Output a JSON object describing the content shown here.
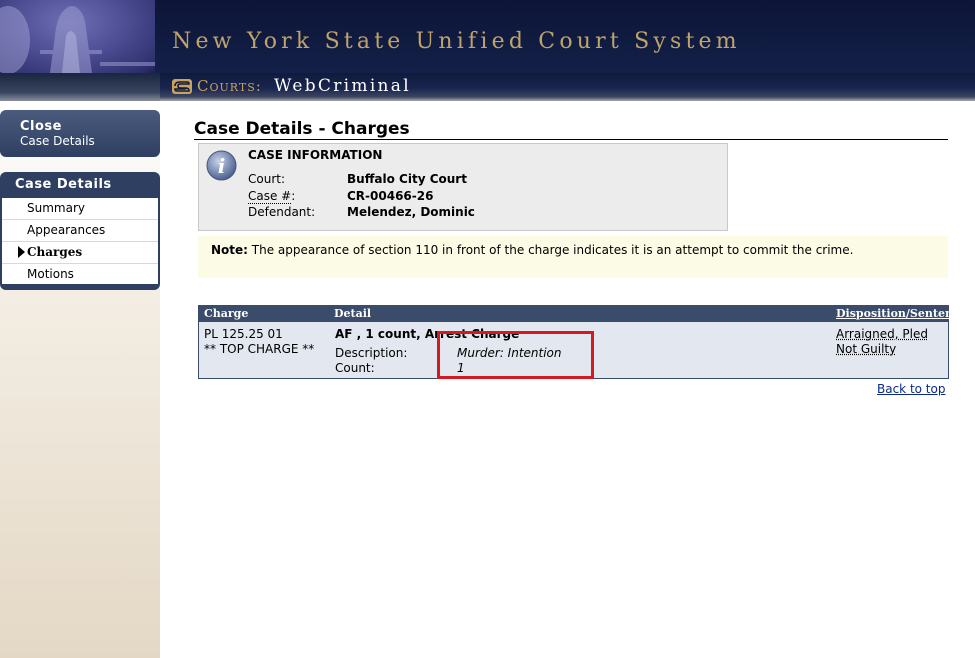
{
  "header": {
    "title": "New York State Unified Court System",
    "courts_label": "Courts:",
    "app_name": "WebCriminal"
  },
  "sidebar": {
    "close": {
      "title": "Close",
      "subtitle": "Case Details"
    },
    "nav_header": "Case Details",
    "items": [
      {
        "label": "Summary",
        "active": false
      },
      {
        "label": "Appearances",
        "active": false
      },
      {
        "label": "Charges",
        "active": true
      },
      {
        "label": "Motions",
        "active": false
      }
    ]
  },
  "main": {
    "page_title": "Case Details - Charges",
    "case_info": {
      "heading": "CASE INFORMATION",
      "icon": "info-icon",
      "court_label": "Court:",
      "court_value": "Buffalo City Court",
      "case_label": "Case #",
      "case_colon": ":",
      "case_value": "CR-00466-26",
      "defendant_label": "Defendant:",
      "defendant_value": "Melendez, Dominic"
    },
    "note": {
      "label": "Note:",
      "text": " The appearance of section 110 in front of the charge indicates it is an attempt to commit the crime."
    },
    "charges_table": {
      "headers": {
        "charge": "Charge",
        "detail": "Detail",
        "disposition": "Disposition/Sentence"
      },
      "row": {
        "charge_code": "PL 125.25 01",
        "charge_flag": "** TOP CHARGE **",
        "detail_title": "AF , 1 count, Arrest Charge",
        "description_label": "Description:",
        "description_value": "Murder: Intention",
        "count_label": "Count:",
        "count_value": "1",
        "disposition_line1": "Arraigned, Pled",
        "disposition_line2": "Not Guilty"
      }
    },
    "back_to_top": "Back to top"
  },
  "colors": {
    "header_bg": "#0c1536",
    "header_text": "#c0a36a",
    "nav_bg": "#2f3f62",
    "table_header": "#3b4c6a",
    "highlight": "#d4191f"
  }
}
